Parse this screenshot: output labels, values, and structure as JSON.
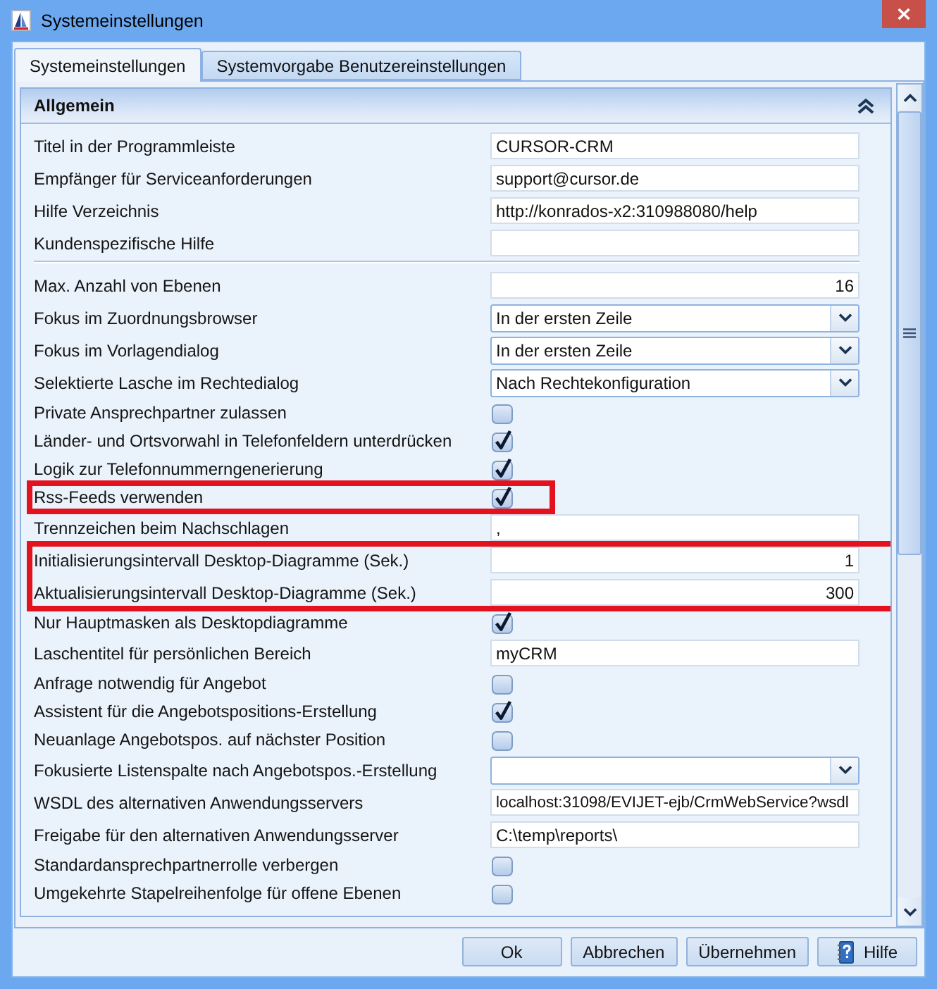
{
  "window": {
    "title": "Systemeinstellungen"
  },
  "tabs": [
    {
      "label": "Systemeinstellungen",
      "selected": true
    },
    {
      "label": "Systemvorgabe Benutzereinstellungen",
      "selected": false
    }
  ],
  "section": {
    "title": "Allgemein",
    "expanded": true,
    "groups": [
      {
        "rows": [
          {
            "kind": "text",
            "label": "Titel in der Programmleiste",
            "value": "CURSOR-CRM"
          },
          {
            "kind": "text",
            "label": "Empfänger für Serviceanforderungen",
            "value": "support@cursor.de"
          },
          {
            "kind": "text",
            "label": "Hilfe Verzeichnis",
            "value": "http://konrados-x2:310988080/help"
          },
          {
            "kind": "text",
            "label": "Kundenspezifische Hilfe"
          }
        ]
      },
      {
        "rows": [
          {
            "kind": "number",
            "label": "Max. Anzahl von Ebenen",
            "value": "16"
          },
          {
            "kind": "dropdown",
            "label": "Fokus im Zuordnungsbrowser",
            "value": "In der ersten Zeile"
          },
          {
            "kind": "dropdown",
            "label": "Fokus im Vorlagendialog",
            "value": "In der ersten Zeile"
          },
          {
            "kind": "dropdown",
            "label": "Selektierte Lasche im Rechtedialog",
            "value": "Nach Rechtekonfiguration"
          },
          {
            "kind": "checkbox",
            "label": "Private Ansprechpartner zulassen",
            "checked": false
          },
          {
            "kind": "checkbox",
            "label": "Länder- und Ortsvorwahl in Telefonfeldern unterdrücken",
            "checked": true
          },
          {
            "kind": "checkbox",
            "label": "Logik zur Telefonnummerngenerierung",
            "checked": true
          },
          {
            "kind": "highlight",
            "rows": [
              {
                "kind": "checkbox",
                "label": "Rss-Feeds verwenden",
                "checked": true
              }
            ]
          },
          {
            "kind": "text",
            "label": "Trennzeichen beim Nachschlagen",
            "value": ","
          },
          {
            "kind": "highlight",
            "rows": [
              {
                "kind": "number",
                "label": "Initialisierungsintervall Desktop-Diagramme (Sek.)",
                "value": "1"
              },
              {
                "kind": "number",
                "label": "Aktualisierungsintervall Desktop-Diagramme (Sek.)",
                "value": "300"
              }
            ]
          },
          {
            "kind": "checkbox",
            "label": "Nur Hauptmasken als Desktopdiagramme",
            "checked": true
          },
          {
            "kind": "text",
            "label": "Laschentitel für persönlichen Bereich",
            "value": "myCRM"
          },
          {
            "kind": "checkbox",
            "label": "Anfrage notwendig für Angebot",
            "checked": false
          },
          {
            "kind": "checkbox",
            "label": "Assistent für die Angebotspositions-Erstellung",
            "checked": true
          },
          {
            "kind": "checkbox",
            "label": "Neuanlage Angebotspos. auf nächster Position",
            "checked": false
          },
          {
            "kind": "dropdown",
            "label": "Fokusierte Listenspalte nach Angebotspos.-Erstellung"
          },
          {
            "kind": "text",
            "label": "WSDL des alternativen Anwendungsservers",
            "value": "localhost:31098/EVIJET-ejb/CrmWebService?wsdl"
          },
          {
            "kind": "text",
            "label": "Freigabe für den alternativen Anwendungsserver",
            "value": "C:\\temp\\reports\\"
          },
          {
            "kind": "checkbox",
            "label": "Standardansprechpartnerrolle verbergen",
            "checked": false
          },
          {
            "kind": "checkbox",
            "label": "Umgekehrte Stapelreihenfolge für offene Ebenen",
            "checked": false
          }
        ]
      }
    ]
  },
  "buttons": [
    {
      "kind": "plain",
      "label": "Ok"
    },
    {
      "kind": "plain",
      "label": "Abbrechen"
    },
    {
      "kind": "plain",
      "label": "Übernehmen"
    },
    {
      "kind": "help",
      "label": "Hilfe"
    }
  ]
}
